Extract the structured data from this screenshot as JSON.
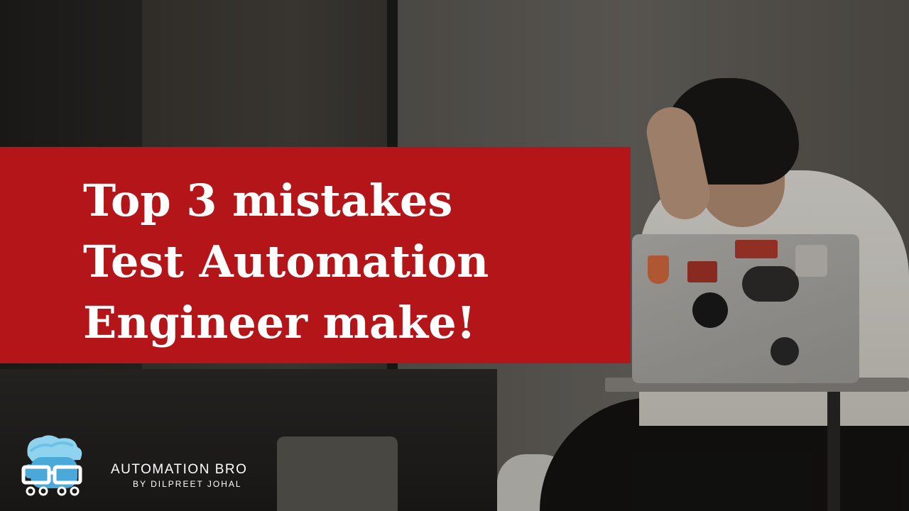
{
  "thumbnail": {
    "title_lines": [
      "Top 3 mistakes",
      "Test Automation",
      "Engineer make!"
    ],
    "banner_color": "#b31519",
    "text_color": "#ffffff"
  },
  "brand": {
    "name": "AUTOMATION BRO",
    "byline": "BY DILPREET JOHAL",
    "logo_icon": "glasses-character-logo-icon",
    "logo_colors": {
      "hair": "#8fd3ee",
      "face": "#4aa9d9",
      "glasses": "#ffffff"
    }
  },
  "background": {
    "scene": "stressed-person-laptop-photo"
  }
}
